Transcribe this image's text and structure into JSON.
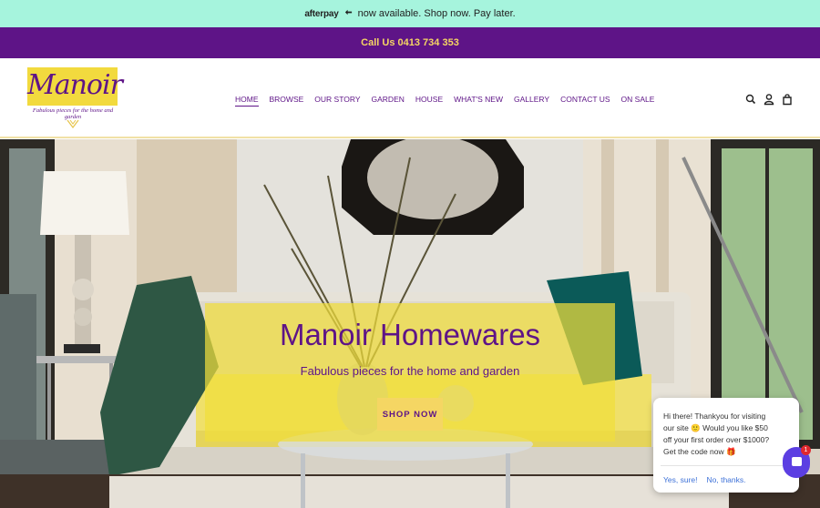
{
  "announcement": {
    "brand": "afterpay",
    "text": "now available. Shop now. Pay later."
  },
  "callbar": {
    "text": "Call Us 0413 734 353"
  },
  "logo": {
    "name": "Manoir",
    "tagline": "Fabulous pieces for the home and garden"
  },
  "nav": {
    "items": [
      {
        "label": "HOME"
      },
      {
        "label": "BROWSE"
      },
      {
        "label": "OUR STORY"
      },
      {
        "label": "GARDEN"
      },
      {
        "label": "HOUSE"
      },
      {
        "label": "WHAT'S NEW"
      },
      {
        "label": "GALLERY"
      },
      {
        "label": "CONTACT US"
      },
      {
        "label": "ON SALE"
      }
    ],
    "active_index": 0
  },
  "header_icons": [
    "search-icon",
    "account-icon",
    "cart-icon"
  ],
  "hero": {
    "title": "Manoir Homewares",
    "subtitle": "Fabulous pieces for the home and garden",
    "button": "SHOP NOW"
  },
  "chat": {
    "message": "Hi there! Thankyou for visiting our site 🙂 Would you like $50 off your first order over $1000? Get the code now 🎁",
    "accept": "Yes, sure!",
    "decline": "No, thanks.",
    "badge": "1"
  },
  "colors": {
    "announce_bg": "#a6f4dd",
    "brand_purple": "#5e1487",
    "brand_yellow": "#f5d663",
    "chat_accent": "#5c3fe2"
  }
}
